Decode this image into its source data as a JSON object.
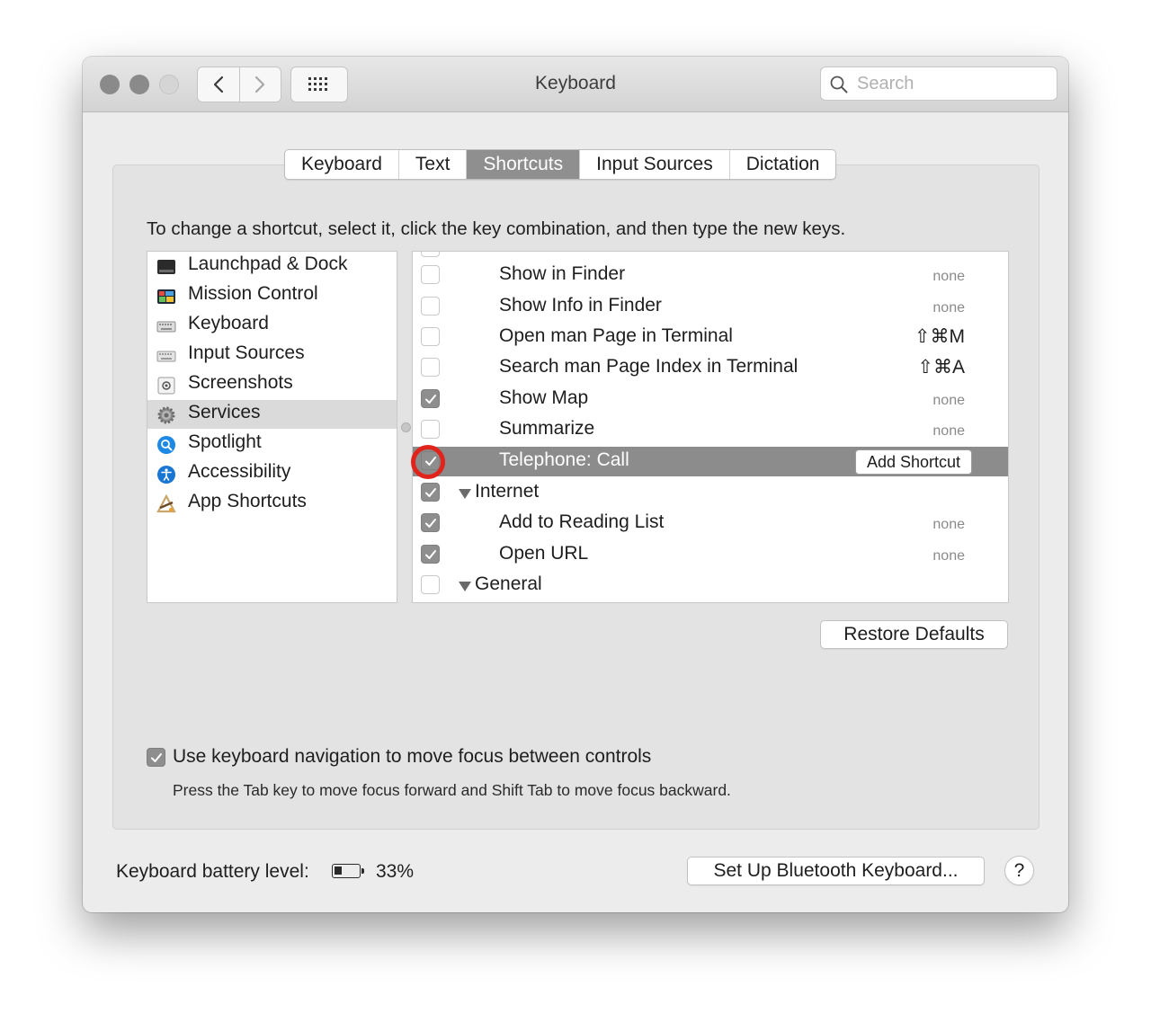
{
  "window": {
    "title": "Keyboard"
  },
  "toolbar": {
    "back_icon": "chevron-left-icon",
    "forward_icon": "chevron-right-icon",
    "grid_icon": "grid-icon"
  },
  "search": {
    "placeholder": "Search"
  },
  "tabs": [
    {
      "label": "Keyboard",
      "active": false
    },
    {
      "label": "Text",
      "active": false
    },
    {
      "label": "Shortcuts",
      "active": true
    },
    {
      "label": "Input Sources",
      "active": false
    },
    {
      "label": "Dictation",
      "active": false
    }
  ],
  "instructions": "To change a shortcut, select it, click the key combination, and then type the new keys.",
  "categories": [
    {
      "label": "Launchpad & Dock",
      "icon": "launchpad-icon",
      "selected": false
    },
    {
      "label": "Mission Control",
      "icon": "mission-control-icon",
      "selected": false
    },
    {
      "label": "Keyboard",
      "icon": "keyboard-icon",
      "selected": false
    },
    {
      "label": "Input Sources",
      "icon": "input-sources-icon",
      "selected": false
    },
    {
      "label": "Screenshots",
      "icon": "screenshots-icon",
      "selected": false
    },
    {
      "label": "Services",
      "icon": "gear-icon",
      "selected": true
    },
    {
      "label": "Spotlight",
      "icon": "spotlight-icon",
      "selected": false
    },
    {
      "label": "Accessibility",
      "icon": "accessibility-icon",
      "selected": false
    },
    {
      "label": "App Shortcuts",
      "icon": "app-shortcuts-icon",
      "selected": false
    }
  ],
  "services": [
    {
      "name": "Show in Finder",
      "checked": false,
      "shortcut": "none"
    },
    {
      "name": "Show Info in Finder",
      "checked": false,
      "shortcut": "none"
    },
    {
      "name": "Open man Page in Terminal",
      "checked": false,
      "shortcut": "⇧⌘M"
    },
    {
      "name": "Search man Page Index in Terminal",
      "checked": false,
      "shortcut": "⇧⌘A"
    },
    {
      "name": "Show Map",
      "checked": true,
      "shortcut": "none"
    },
    {
      "name": "Summarize",
      "checked": false,
      "shortcut": "none"
    },
    {
      "name": "Telephone: Call",
      "checked": true,
      "selected": true,
      "button": "Add Shortcut"
    },
    {
      "group": "Internet",
      "checked": true
    },
    {
      "name": "Add to Reading List",
      "checked": true,
      "shortcut": "none"
    },
    {
      "name": "Open URL",
      "checked": true,
      "shortcut": "none"
    },
    {
      "group": "General",
      "checked": false
    }
  ],
  "restore_defaults": "Restore Defaults",
  "keyboard_nav": {
    "label": "Use keyboard navigation to move focus between controls",
    "checked": true,
    "subtext": "Press the Tab key to move focus forward and Shift Tab to move focus backward."
  },
  "battery": {
    "label": "Keyboard battery level:",
    "percent": "33%",
    "level": 0.33
  },
  "bluetooth_button": "Set Up Bluetooth Keyboard...",
  "help_label": "?",
  "colors": {
    "selected_row": "#8c8c8c",
    "highlight_ring": "#e0241b",
    "active_tab": "#8f8f8f"
  }
}
